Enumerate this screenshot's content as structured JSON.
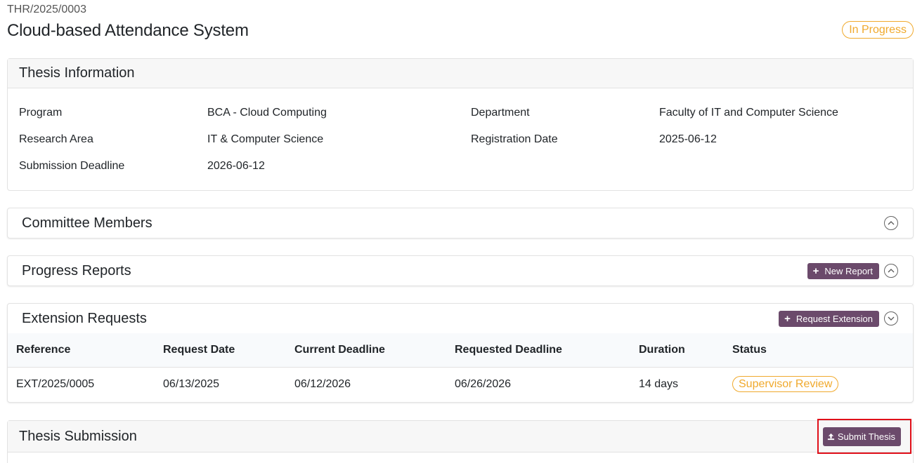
{
  "header": {
    "reference": "THR/2025/0003",
    "title": "Cloud-based Attendance System",
    "status": "In Progress",
    "status_color": "#f0a92c"
  },
  "thesis_info": {
    "title": "Thesis Information",
    "fields": [
      {
        "label": "Program",
        "value": "BCA - Cloud Computing"
      },
      {
        "label": "Department",
        "value": "Faculty of IT and Computer Science"
      },
      {
        "label": "Research Area",
        "value": "IT & Computer Science"
      },
      {
        "label": "Registration Date",
        "value": "2025-06-12"
      },
      {
        "label": "Submission Deadline",
        "value": "2026-06-12"
      }
    ]
  },
  "committee": {
    "title": "Committee Members",
    "toggle_icon": "chevron-up-icon"
  },
  "progress": {
    "title": "Progress Reports",
    "button_label": "New Report",
    "toggle_icon": "chevron-up-icon"
  },
  "extension": {
    "title": "Extension Requests",
    "button_label": "Request Extension",
    "toggle_icon": "chevron-down-icon",
    "columns": [
      "Reference",
      "Request Date",
      "Current Deadline",
      "Requested Deadline",
      "Duration",
      "Status"
    ],
    "rows": [
      {
        "reference": "EXT/2025/0005",
        "request_date": "06/13/2025",
        "current_deadline": "06/12/2026",
        "requested_deadline": "06/26/2026",
        "duration": "14 days",
        "status": "Supervisor Review"
      }
    ]
  },
  "submission": {
    "title": "Thesis Submission",
    "button_label": "Submit Thesis",
    "button_icon": "upload-icon"
  },
  "colors": {
    "accent": "#6b4a6b",
    "warning": "#f0a92c",
    "highlight": "#e0101a"
  }
}
